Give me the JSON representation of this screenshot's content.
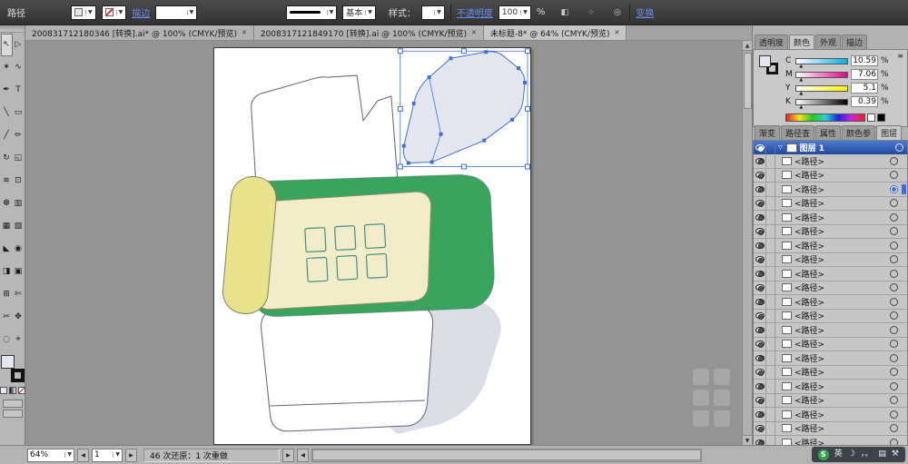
{
  "theme": {
    "selection_blue": "#3f6fd6",
    "link_blue": "#6b8ef0",
    "layers_header_top": "#4a7bd0",
    "layers_header_bottom": "#24479c"
  },
  "icons": {
    "caret": "▼",
    "up": "▲",
    "down": "▼",
    "left": "◀",
    "right": "▶",
    "close": "✕",
    "menu": "≡",
    "expand": "▽"
  },
  "control_bar": {
    "context_label": "路径",
    "stroke_link": "描边",
    "brush_value": "基本",
    "style_label": "样式：",
    "opacity_link": "不透明度",
    "opacity_value": "100",
    "opacity_unit": "%",
    "transform_link": "变换"
  },
  "control_bar_icons": [
    {
      "name": "shape-mode-icon",
      "glyph": "◧"
    },
    {
      "name": "align-dots-icon",
      "glyph": "⁘"
    },
    {
      "name": "isolate-mode-icon",
      "glyph": "◎"
    }
  ],
  "document_tabs": [
    {
      "label": "200831712180346 [转换].ai* @ 100% (CMYK/预览)",
      "active": false
    },
    {
      "label": "2008317121849170 [转换].ai @ 100% (CMYK/预览)",
      "active": false
    },
    {
      "label": "未标题-8* @ 64% (CMYK/预览)",
      "active": true
    }
  ],
  "toolbox": {
    "tools": [
      {
        "name": "selection-tool",
        "glyph": "↖"
      },
      {
        "name": "direct-selection-tool",
        "glyph": "▷"
      },
      {
        "name": "magic-wand-tool",
        "glyph": "✶"
      },
      {
        "name": "lasso-tool",
        "glyph": "∿"
      },
      {
        "name": "pen-tool",
        "glyph": "✒"
      },
      {
        "name": "type-tool",
        "glyph": "T"
      },
      {
        "name": "line-segment-tool",
        "glyph": "╲"
      },
      {
        "name": "rectangle-tool",
        "glyph": "▭"
      },
      {
        "name": "paintbrush-tool",
        "glyph": "╱"
      },
      {
        "name": "pencil-tool",
        "glyph": "✏"
      },
      {
        "name": "rotate-tool",
        "glyph": "↻"
      },
      {
        "name": "scale-tool",
        "glyph": "◱"
      },
      {
        "name": "warp-tool",
        "glyph": "≋"
      },
      {
        "name": "free-transform-tool",
        "glyph": "⊡"
      },
      {
        "name": "symbol-sprayer-tool",
        "glyph": "❆"
      },
      {
        "name": "graph-tool",
        "glyph": "▥"
      },
      {
        "name": "mesh-tool",
        "glyph": "▦"
      },
      {
        "name": "gradient-tool",
        "glyph": "▧"
      },
      {
        "name": "eyedropper-tool",
        "glyph": "◣"
      },
      {
        "name": "blend-tool",
        "glyph": "◉"
      },
      {
        "name": "live-paint-bucket-tool",
        "glyph": "◨"
      },
      {
        "name": "live-paint-selection-tool",
        "glyph": "▣"
      },
      {
        "name": "crop-area-tool",
        "glyph": "⊞"
      },
      {
        "name": "slice-tool",
        "glyph": "✄"
      },
      {
        "name": "scissors-tool",
        "glyph": "✂"
      },
      {
        "name": "hand-tool",
        "glyph": "✥"
      },
      {
        "name": "zoom-tool",
        "glyph": "◌"
      },
      {
        "name": "artboard-tool",
        "glyph": "⌖"
      }
    ]
  },
  "color_panel": {
    "tabs": [
      {
        "label": "透明度",
        "active": false,
        "name": "tab-transparency"
      },
      {
        "label": "颜色",
        "active": true,
        "name": "tab-color"
      },
      {
        "label": "外观",
        "active": false,
        "name": "tab-appearance"
      },
      {
        "label": "描边",
        "active": false,
        "name": "tab-stroke"
      }
    ],
    "channels": [
      {
        "name": "C",
        "value": "10.59",
        "unit": "%",
        "hex": "#00aeef",
        "gradient": "linear-gradient(to right,#ffffff,#00aeef)"
      },
      {
        "name": "M",
        "value": "7.06",
        "unit": "%",
        "hex": "#ec008c",
        "gradient": "linear-gradient(to right,#ffffff,#ec008c)"
      },
      {
        "name": "Y",
        "value": "5.1",
        "unit": "%",
        "hex": "#fff200",
        "gradient": "linear-gradient(to right,#ffffff,#fff200)"
      },
      {
        "name": "K",
        "value": "0.39",
        "unit": "%",
        "hex": "#000000",
        "gradient": "linear-gradient(to right,#ffffff,#000000)"
      }
    ]
  },
  "dock_tabs2": [
    {
      "label": "渐变",
      "active": false,
      "name": "tab-gradient"
    },
    {
      "label": "路径查",
      "active": false,
      "name": "tab-pathfinder"
    },
    {
      "label": "属性",
      "active": false,
      "name": "tab-attributes"
    },
    {
      "label": "颜色参",
      "active": false,
      "name": "tab-color-guide"
    },
    {
      "label": "图层",
      "active": true,
      "name": "tab-layers"
    }
  ],
  "layers_panel": {
    "layer_name": "图层 1",
    "rows": [
      {
        "label": "<路径>"
      },
      {
        "label": "<路径>"
      },
      {
        "label": "<路径>",
        "selected": true
      },
      {
        "label": "<路径>"
      },
      {
        "label": "<路径>"
      },
      {
        "label": "<路径>"
      },
      {
        "label": "<路径>"
      },
      {
        "label": "<路径>"
      },
      {
        "label": "<路径>"
      },
      {
        "label": "<路径>"
      },
      {
        "label": "<路径>"
      },
      {
        "label": "<路径>"
      },
      {
        "label": "<路径>"
      },
      {
        "label": "<路径>"
      },
      {
        "label": "<路径>"
      },
      {
        "label": "<路径>"
      },
      {
        "label": "<路径>"
      },
      {
        "label": "<路径>"
      },
      {
        "label": "<路径>"
      },
      {
        "label": "<路径>"
      },
      {
        "label": "<路径>"
      }
    ]
  },
  "status_bar": {
    "zoom": "64%",
    "page": "1",
    "history": "46 次还原：1 次重做"
  },
  "ime_bar": {
    "logo": "S",
    "lang": "英",
    "moon": "☽",
    "punct": "，。",
    "keyboard": "▤",
    "tools": "⚒"
  },
  "artwork": {
    "colors": {
      "paper": "#ffffff",
      "outline": "#5a6472",
      "selected_fill": "#e4e7f0",
      "green": "#3aa35e",
      "cream": "#f2ecc9",
      "cream_outline": "#8e8e68",
      "yellow": "#e9e28d",
      "yellow_outline": "#83835a",
      "tray_grey": "#dbdee7",
      "teal": "#3f8f85"
    }
  }
}
